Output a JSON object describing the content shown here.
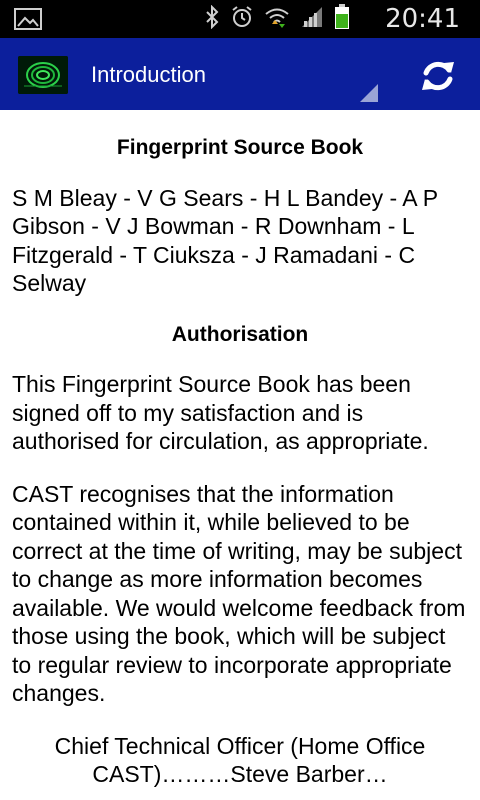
{
  "status_bar": {
    "time": "20:41",
    "icons": [
      "image-icon",
      "bluetooth-icon",
      "alarm-icon",
      "wifi-icon",
      "signal-icon",
      "battery-icon"
    ],
    "battery_color": "#3fb21c"
  },
  "action_bar": {
    "title": "Introduction",
    "background_color": "#0c1f9c",
    "logo_icon": "fingerprint-logo-icon",
    "refresh_icon": "refresh-icon"
  },
  "content": {
    "heading_main": "Fingerprint Source Book",
    "authors": "S M Bleay - V G Sears - H L Bandey - A P Gibson - V J Bowman - R Downham - L Fitzgerald - T Ciuksza - J Ramadani - C Selway",
    "heading_authorisation": "Authorisation",
    "paragraph_1": "This Fingerprint Source Book has been signed off to my satisfaction and is authorised for circulation, as appropriate.",
    "paragraph_2": "CAST recognises that the information contained within it, while believed to be correct at the time of writing, may be subject to change as more information becomes available. We would welcome feedback from those using the book, which will be subject to regular review to incorporate appropriate changes.",
    "signature": "Chief Technical Officer (Home Office CAST)………Steve Barber…"
  }
}
